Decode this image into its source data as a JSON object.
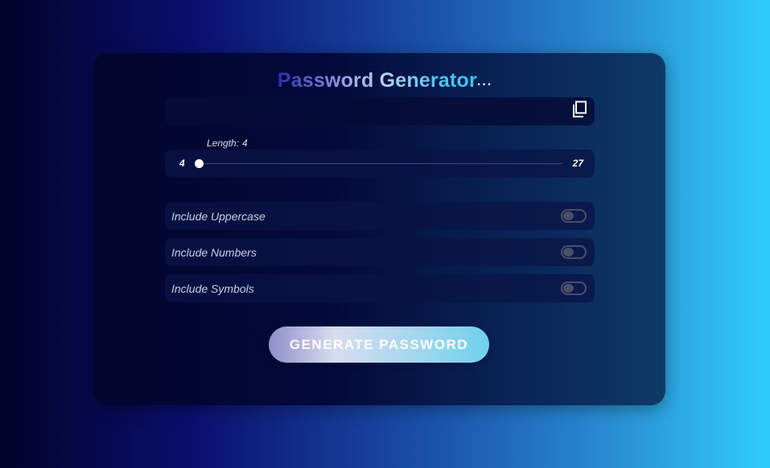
{
  "app": {
    "title": "Password Generator",
    "title_suffix": "..."
  },
  "password": {
    "value": ""
  },
  "length": {
    "label": "Length:",
    "value": "4",
    "min": "4",
    "max": "27",
    "current": 4
  },
  "options": [
    {
      "label": "Include Uppercase",
      "checked": false
    },
    {
      "label": "Include Numbers",
      "checked": false
    },
    {
      "label": "Include Symbols",
      "checked": false
    }
  ],
  "actions": {
    "generate_label": "GENERATE PASSWORD"
  },
  "icons": {
    "copy": "copy-icon"
  },
  "colors": {
    "accent_start": "#0a0f6e",
    "accent_end": "#30cdfa",
    "toggle_off": "#4a4f66"
  }
}
